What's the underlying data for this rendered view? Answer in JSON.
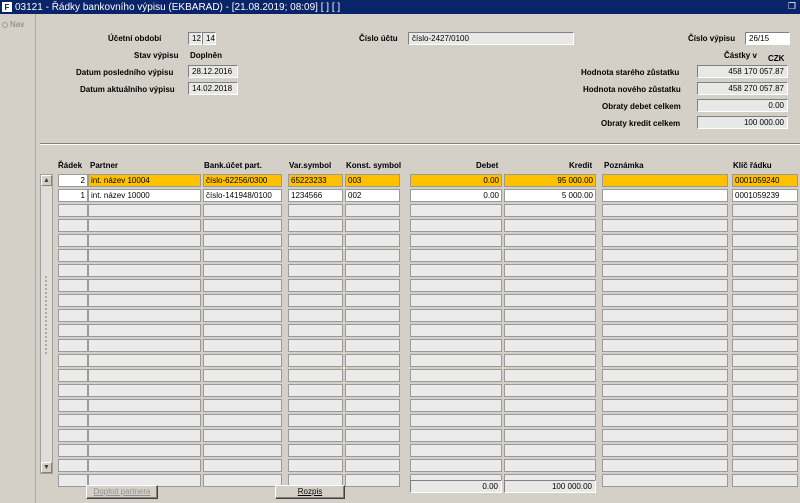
{
  "window": {
    "title": "03121 - Řádky bankovního výpisu (EKBARAD) - [21.08.2019; 08:09]  [ ]  [ ]",
    "restore_symbol": "❐"
  },
  "nav": {
    "label": "Nav"
  },
  "header": {
    "ucetni_obdobi_label": "Účetní období",
    "ucetni_obdobi_1": "12",
    "ucetni_obdobi_2": "14",
    "cislo_uctu_label": "Číslo účtu",
    "cislo_uctu_value": "číslo-2427/0100",
    "cislo_vypisu_label": "Číslo výpisu",
    "cislo_vypisu_value": "26/15",
    "stav_vypisu_label": "Stav výpisu",
    "stav_vypisu_value": "Doplněn",
    "castky_label": "Částky v",
    "castky_currency": "CZK",
    "datum_posledniho_label": "Datum posledního výpisu",
    "datum_posledniho_value": "28.12.2016",
    "datum_aktualniho_label": "Datum aktuálního výpisu",
    "datum_aktualniho_value": "14.02.2018",
    "hodnota_stareho_label": "Hodnota starého zůstatku",
    "hodnota_stareho_value": "458 170 057.87",
    "hodnota_noveho_label": "Hodnota nového zůstatku",
    "hodnota_noveho_value": "458 270 057.87",
    "obraty_debet_label": "Obraty debet celkem",
    "obraty_debet_value": "0.00",
    "obraty_kredit_label": "Obraty kredit celkem",
    "obraty_kredit_value": "100 000.00"
  },
  "table": {
    "columns": {
      "radek": "Řádek",
      "partner": "Partner",
      "bank_ucet": "Bank.účet part.",
      "var_symbol": "Var.symbol",
      "konst_symbol": "Konst. symbol",
      "debet": "Debet",
      "kredit": "Kredit",
      "poznamka": "Poznámka",
      "klic": "Klíč řádku"
    },
    "rows": [
      {
        "radek": "2",
        "partner": "int. název 10004",
        "bank_ucet": "číslo-62256/0300",
        "var_symbol": "65223233",
        "konst_symbol": "003",
        "debet": "0.00",
        "kredit": "95 000.00",
        "poznamka": "",
        "klic": "0001059240"
      },
      {
        "radek": "1",
        "partner": "int. název 10000",
        "bank_ucet": "číslo-141948/0100",
        "var_symbol": "1234566",
        "konst_symbol": "002",
        "debet": "0.00",
        "kredit": "5 000.00",
        "poznamka": "",
        "klic": "0001059239"
      }
    ],
    "empty_row_count": 19
  },
  "totals": {
    "debet": "0.00",
    "kredit": "100 000.00"
  },
  "buttons": {
    "doplnit_partnera": "Doplnit partnera",
    "rozpis": "Rozpis"
  },
  "colors": {
    "titlebar": "#0a246a",
    "selected_row": "#ffc000",
    "background": "#d4d0c8"
  }
}
